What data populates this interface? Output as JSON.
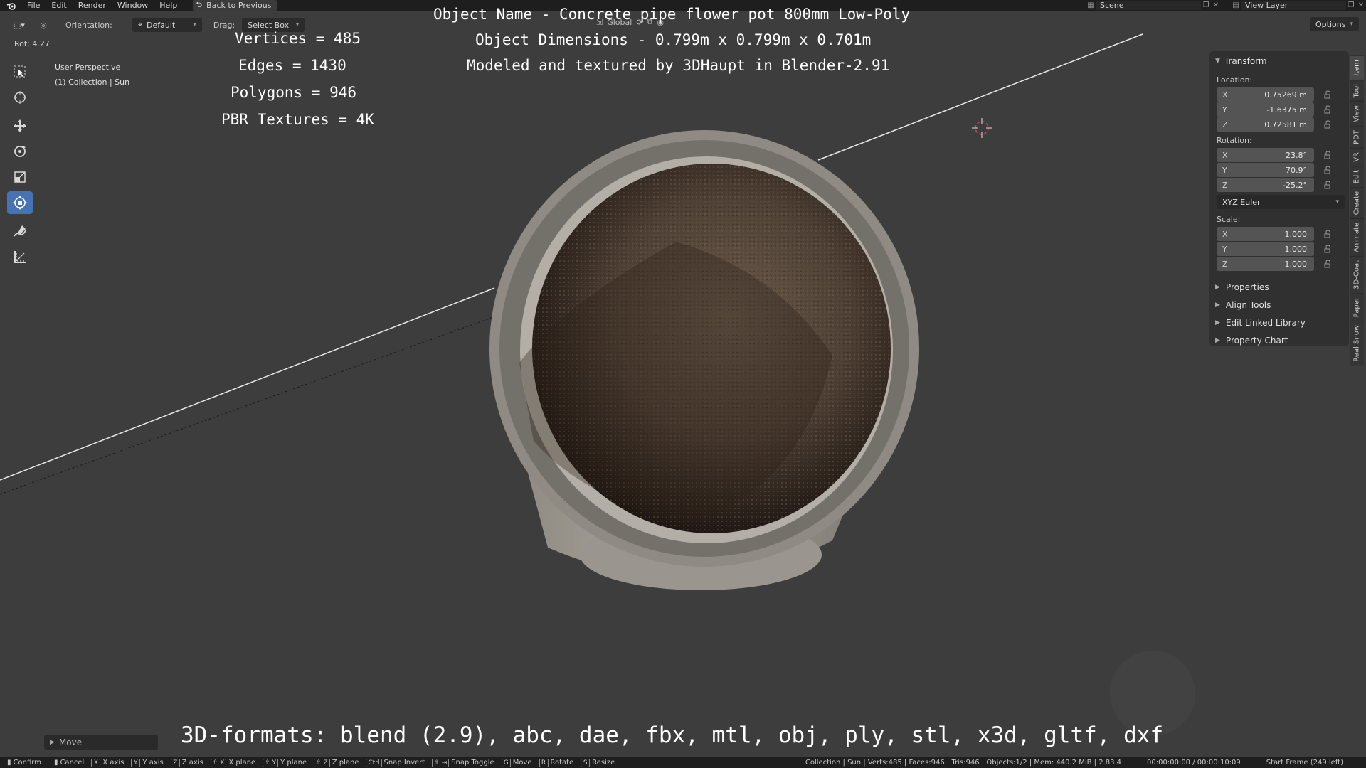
{
  "menubar": {
    "items": [
      "File",
      "Edit",
      "Render",
      "Window",
      "Help"
    ],
    "back_button": "Back to Previous",
    "scene": "Scene",
    "view_layer": "View Layer"
  },
  "header": {
    "orientation_label": "Orientation:",
    "orientation_value": "Default",
    "drag_label": "Drag:",
    "drag_value": "Select Box",
    "transform_orientation": "Global",
    "options_label": "Options"
  },
  "viewport": {
    "rotation_readout": "Rot: 4.27",
    "perspective": "User Perspective",
    "collection": "(1) Collection | Sun"
  },
  "overlay": {
    "vertices": "Vertices = 485",
    "edges": "Edges = 1430",
    "polygons": "Polygons = 946",
    "textures": "PBR Textures = 4K",
    "object_name": "Object Name - Concrete pipe flower pot 800mm Low-Poly",
    "dimensions": "Object Dimensions -  0.799m x 0.799m x 0.701m",
    "credit": "Modeled and textured by 3DHaupt in Blender-2.91",
    "formats": "3D-formats: blend (2.9), abc, dae, fbx, mtl, obj, ply, stl, x3d, gltf, dxf"
  },
  "sidebar": {
    "transform_title": "Transform",
    "location_label": "Location:",
    "location": [
      {
        "axis": "X",
        "value": "0.75269 m"
      },
      {
        "axis": "Y",
        "value": "-1.6375 m"
      },
      {
        "axis": "Z",
        "value": "0.72581 m"
      }
    ],
    "rotation_label": "Rotation:",
    "rotation": [
      {
        "axis": "X",
        "value": "23.8°"
      },
      {
        "axis": "Y",
        "value": "70.9°"
      },
      {
        "axis": "Z",
        "value": "-25.2°"
      }
    ],
    "rotation_mode": "XYZ Euler",
    "scale_label": "Scale:",
    "scale": [
      {
        "axis": "X",
        "value": "1.000"
      },
      {
        "axis": "Y",
        "value": "1.000"
      },
      {
        "axis": "Z",
        "value": "1.000"
      }
    ],
    "panels": [
      "Properties",
      "Align Tools",
      "Edit Linked Library",
      "Property Chart"
    ]
  },
  "vertical_tabs": [
    "Item",
    "Tool",
    "View",
    "PDT",
    "VR",
    "Edit",
    "Create",
    "Animate",
    "3D-Coat",
    "Paper",
    "Real Snow"
  ],
  "redo_panel": {
    "label": "Move"
  },
  "statusbar": {
    "hints": [
      {
        "key": "",
        "label": "Confirm"
      },
      {
        "key": "",
        "label": "Cancel"
      },
      {
        "key": "X",
        "label": "X axis"
      },
      {
        "key": "Y",
        "label": "Y axis"
      },
      {
        "key": "Z",
        "label": "Z axis"
      },
      {
        "key": "⇧ X",
        "label": "X plane"
      },
      {
        "key": "⇧ Y",
        "label": "Y plane"
      },
      {
        "key": "⇧ Z",
        "label": "Z plane"
      },
      {
        "key": "Ctrl",
        "label": "Snap Invert"
      },
      {
        "key": "⇧ ⇥",
        "label": "Snap Toggle"
      },
      {
        "key": "G",
        "label": "Move"
      },
      {
        "key": "R",
        "label": "Rotate"
      },
      {
        "key": "S",
        "label": "Resize"
      }
    ],
    "stats": "Collection | Sun | Verts:485 | Faces:946 | Tris:946 | Objects:1/2 | Mem: 440.2 MiB | 2.83.4",
    "timecode": "00:00:00:00 / 00:00:10:09",
    "start_frame": "Start Frame (249 left)"
  },
  "colors": {
    "viewport_bg": "#3d3d3d",
    "active_tool": "#4772b3",
    "panel_bg": "#303030"
  }
}
